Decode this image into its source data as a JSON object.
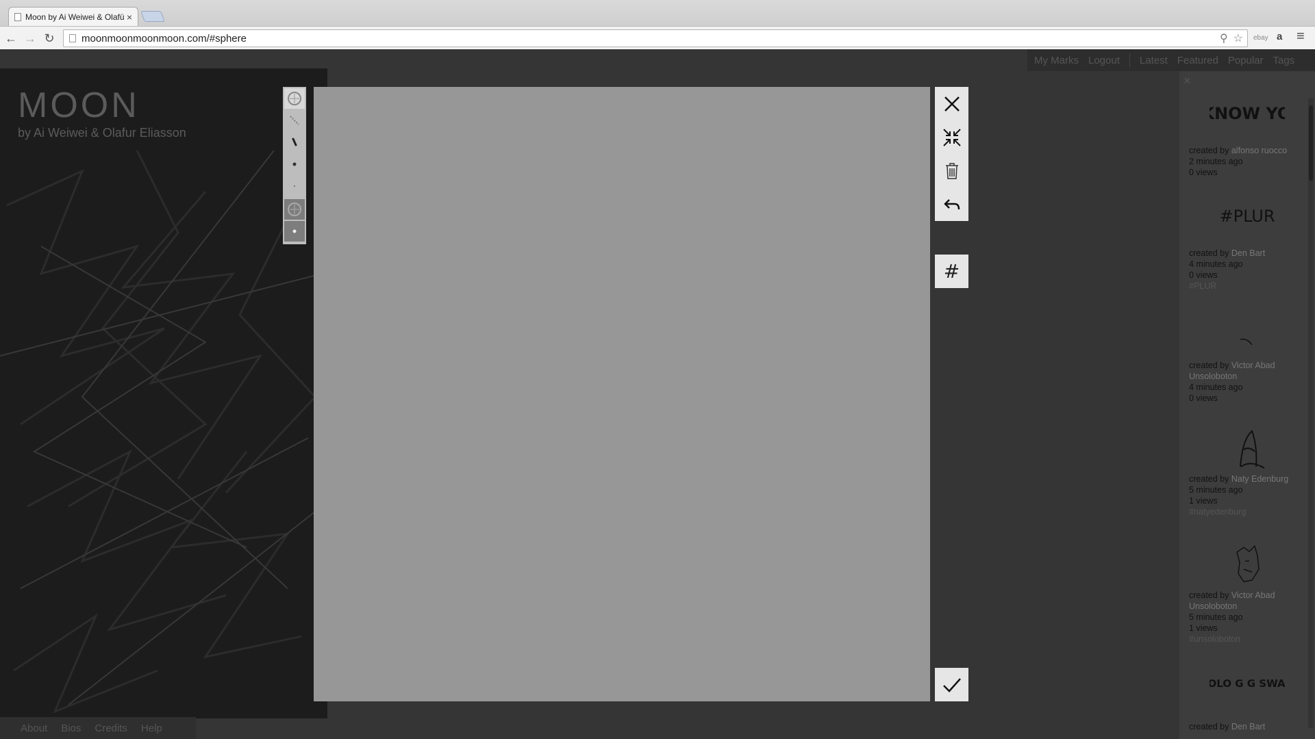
{
  "browser": {
    "tab_title": "Moon by Ai Weiwei & Olafü",
    "tab_close": "×",
    "url": "moonmoonmoonmoon.com/#sphere",
    "ext_ebay": "ebay",
    "ext_amazon": "a",
    "menu_glyph": "≡"
  },
  "site": {
    "title": "MOON",
    "subtitle": "by Ai Weiwei & Olafur Eliasson",
    "footer_links": [
      "About",
      "Bios",
      "Credits",
      "Help"
    ],
    "topnav": {
      "my_marks": "My Marks",
      "logout": "Logout",
      "latest": "Latest",
      "featured": "Featured",
      "popular": "Popular",
      "tags": "Tags"
    }
  },
  "sidebar": {
    "close": "×",
    "marks": [
      {
        "art_text": "I KNOW YOU",
        "created_by": "created by",
        "author": "alfonso ruocco",
        "time": "2 minutes ago",
        "views": "0 views",
        "tag": ""
      },
      {
        "art_text": "#PLUR",
        "created_by": "created by",
        "author": "Den Bart",
        "time": "4 minutes ago",
        "views": "0 views",
        "tag": "#PLUR"
      },
      {
        "art_text": "",
        "created_by": "created by",
        "author": "Victor Abad Unsoloboton",
        "time": "4 minutes ago",
        "views": "0 views",
        "tag": ""
      },
      {
        "art_text": "",
        "created_by": "created by",
        "author": "Naty Edenburg",
        "time": "5 minutes ago",
        "views": "1 views",
        "tag": "#natyedenburg"
      },
      {
        "art_text": "",
        "created_by": "created by",
        "author": "Victor Abad Unsoloboton",
        "time": "5 minutes ago",
        "views": "1 views",
        "tag": "#unsoloboton"
      },
      {
        "art_text": "YOLO G G SWAG",
        "created_by": "created by",
        "author": "Den Bart",
        "time": "",
        "views": "",
        "tag": ""
      }
    ]
  },
  "editor": {
    "hash_symbol": "#"
  }
}
